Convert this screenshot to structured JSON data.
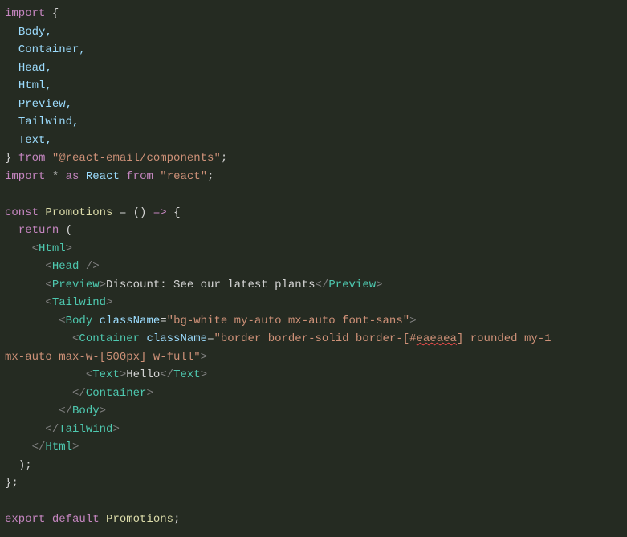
{
  "code": {
    "import_kw1": "import",
    "import_names": [
      "Body,",
      "Container,",
      "Head,",
      "Html,",
      "Preview,",
      "Tailwind,",
      "Text,"
    ],
    "from_kw1": "from",
    "module1": "\"@react-email/components\"",
    "import_kw2": "import",
    "star": "*",
    "as_kw": "as",
    "react_ident": "React",
    "from_kw2": "from",
    "module2": "\"react\"",
    "const_kw": "const",
    "comp_name_decl": "Promotions",
    "arrow_params": "()",
    "arrow": "=>",
    "return_kw": "return",
    "tag_Html": "Html",
    "tag_Head": "Head",
    "tag_Preview": "Preview",
    "preview_text": "Discount: See our latest plants",
    "tag_Tailwind": "Tailwind",
    "tag_Body": "Body",
    "attr_className": "className",
    "body_class": "\"bg-white my-auto mx-auto font-sans\"",
    "tag_Container": "Container",
    "container_class_pre": "\"border border-solid border-[#",
    "container_class_hex": "eaeaea",
    "container_class_mid": "] rounded my-1",
    "container_class_wrap": "mx-auto max-w-[500px] w-full\"",
    "tag_Text": "Text",
    "text_content": "Hello",
    "export_kw": "export",
    "default_kw": "default",
    "comp_name_export": "Promotions"
  }
}
